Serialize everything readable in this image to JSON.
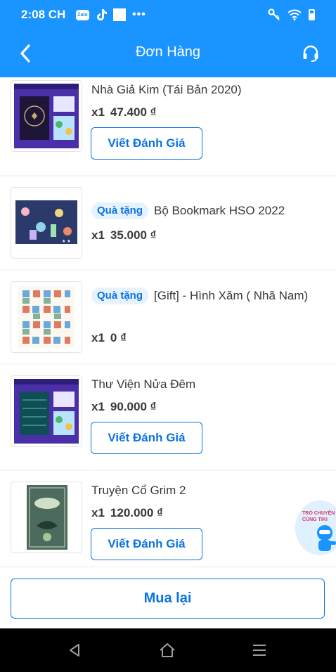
{
  "status_bar": {
    "time": "2:08 CH",
    "app_icons": [
      "zalo-icon",
      "tiktok-icon",
      "square-icon",
      "more-dots-icon"
    ],
    "right_icons": [
      "key-icon",
      "wifi-icon",
      "battery-icon"
    ],
    "zalo_text": "Zalo",
    "dots": "•••"
  },
  "header": {
    "title": "Đơn Hàng",
    "back_icon": "back-arrow-icon",
    "support_icon": "headset-icon",
    "color": "#1a94ff"
  },
  "order_items": [
    {
      "name": "Nhà Giả Kim (Tái Bản 2020)",
      "gift": false,
      "qty": "x1",
      "price": "47.400 ₫",
      "review_label": "Viết Đánh Giá",
      "cover": "nha-gia-kim-cover"
    },
    {
      "name": "Bộ Bookmark HSO 2022",
      "gift": true,
      "gift_label": "Quà tặng",
      "qty": "x1",
      "price": "35.000 ₫",
      "cover": "bookmark-cover"
    },
    {
      "name": "[Gift] - Hình Xăm ( Nhã Nam)",
      "gift": true,
      "gift_label": "Quà tặng",
      "qty": "x1",
      "price": "0 ₫",
      "cover": "sticker-sheet-cover"
    },
    {
      "name": "Thư Viện Nửa Đêm",
      "gift": false,
      "qty": "x1",
      "price": "90.000 ₫",
      "review_label": "Viết Đánh Giá",
      "cover": "thu-vien-nua-dem-cover"
    },
    {
      "name": "Truyện Cổ Grim 2",
      "gift": false,
      "qty": "x1",
      "price": "120.000 ₫",
      "review_label": "Viết Đánh Giá",
      "cover": "truyen-co-grim-cover"
    }
  ],
  "chat_widget": {
    "text": "TRÒ CHUYỆN CÙNG TIKI"
  },
  "bottom": {
    "rebuy_label": "Mua lại"
  },
  "nav": {
    "icons": [
      "back-triangle-icon",
      "home-icon",
      "menu-icon"
    ]
  },
  "colors": {
    "accent": "#0b74e5",
    "header": "#1a94ff",
    "gift_bg": "#e6f3ff"
  }
}
